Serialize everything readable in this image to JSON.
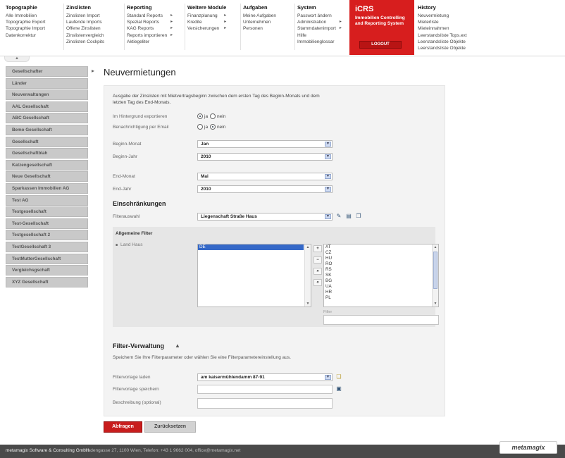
{
  "nav": {
    "columns": [
      {
        "title": "Topographie",
        "items": [
          {
            "label": "Alle Immobilien",
            "arrow": false
          },
          {
            "label": "Topographie Export",
            "arrow": false
          },
          {
            "label": "Topographie Import",
            "arrow": false
          },
          {
            "label": "Datenkorrektur",
            "arrow": false
          }
        ]
      },
      {
        "title": "Zinslisten",
        "items": [
          {
            "label": "Zinslisten Import",
            "arrow": false
          },
          {
            "label": "Laufende Imports",
            "arrow": false
          },
          {
            "label": "Offene Zinslisten",
            "arrow": false
          },
          {
            "label": "Zinslistenvergleich",
            "arrow": false
          },
          {
            "label": "Zinslisten Cockpits",
            "arrow": false
          }
        ]
      },
      {
        "title": "Reporting",
        "items": [
          {
            "label": "Standard Reports",
            "arrow": true
          },
          {
            "label": "Spezial Reports",
            "arrow": true
          },
          {
            "label": "KAG Reports",
            "arrow": true
          },
          {
            "label": "Reports importieren",
            "arrow": true
          },
          {
            "label": "Aktiegeliter",
            "arrow": false
          }
        ]
      },
      {
        "title": "Weitere Module",
        "items": [
          {
            "label": "Finanzplanung",
            "arrow": true
          },
          {
            "label": "Kredite",
            "arrow": true
          },
          {
            "label": "Versicherungen",
            "arrow": true
          }
        ]
      },
      {
        "title": "Aufgaben",
        "items": [
          {
            "label": "Meine Aufgaben",
            "arrow": false
          },
          {
            "label": "Unternehmen",
            "arrow": false
          },
          {
            "label": "Personen",
            "arrow": false
          }
        ]
      },
      {
        "title": "System",
        "items": [
          {
            "label": "Passwort ändern",
            "arrow": false
          },
          {
            "label": "Administration",
            "arrow": true
          },
          {
            "label": "Stammdatenimport",
            "arrow": true
          },
          {
            "label": "Hilfe",
            "arrow": false
          },
          {
            "label": "Immobilienglossar",
            "arrow": false
          }
        ]
      },
      {
        "title": "History",
        "items": [
          {
            "label": "Neuvermietung",
            "arrow": false
          },
          {
            "label": "Mieterliste",
            "arrow": false
          },
          {
            "label": "Mieteinnahmen",
            "arrow": false
          },
          {
            "label": "Leerstandsliste Tops.ext",
            "arrow": false
          },
          {
            "label": "Leerstandsliste Objekte",
            "arrow": false
          },
          {
            "label": "Leerstandsliste Objekte",
            "arrow": false
          }
        ]
      }
    ],
    "brand": {
      "title": "iCRS",
      "subtitle": "Immobilien Controlling and Reporting System",
      "logout": "LOGOUT"
    }
  },
  "sidebar": {
    "items": [
      "Gesellschafter",
      "Länder",
      "Neuverwaltungen",
      "AAL Gesellschaft",
      "ABC Gesellschaft",
      "Bemo Gesellschaft",
      "Gesellschaft",
      "Gesellschaftblah",
      "Katzengesellschaft",
      "Neue Gesellschaft",
      "Sparkassen Immobilien AG",
      "Test AG",
      "Testgesellschaft",
      "Test-Gesellschaft",
      "Testgesellschaft 2",
      "TestGesellschaft 3",
      "TestMutterGesellschaft",
      "Vergleichsgschaft",
      "XYZ Gesellschaft"
    ]
  },
  "page": {
    "title": "Neuvermietungen"
  },
  "form": {
    "description": "Ausgabe der Zinslisten mit Mietvertragsbeginn zwischen dem ersten Tag des Beginn-Monats und dem letzten Tag des End-Monats.",
    "bg_label": "Im Hintergrund exportieren",
    "email_label": "Benachrichtigung per Email",
    "ja": "ja",
    "nein": "nein",
    "begin_month_label": "Beginn-Monat",
    "begin_month": "Jan",
    "begin_year_label": "Beginn-Jahr",
    "begin_year": "2010",
    "end_month_label": "End-Monat",
    "end_month": "Mai",
    "end_year_label": "End-Jahr",
    "end_year": "2010"
  },
  "restrictions": {
    "heading": "Einschränkungen",
    "filter_label": "Filterauswahl",
    "filter_value": "Liegenschaft Straße Haus",
    "general_heading": "Allgemeine Filter",
    "tree_item": "Land Haus",
    "selected": [
      "DE"
    ],
    "available": [
      "AT",
      "CZ",
      "HU",
      "RO",
      "RS",
      "SK",
      "BG",
      "UA",
      "HR",
      "PL"
    ],
    "move_buttons": [
      "+",
      "−",
      "»",
      "«"
    ],
    "filter_caption": "Filter"
  },
  "filter_mgmt": {
    "heading": "Filter-Verwaltung",
    "description": "Speichern Sie Ihre Filterparameter oder wählen Sie eine Filterparametereinstellung aus.",
    "load_label": "Filtervorlage laden",
    "load_value": "am kaisermühlendamm 87-91",
    "save_label": "Filtervorlage speichern",
    "desc_label": "Beschreibung (optional)"
  },
  "buttons": {
    "submit": "Abfragen",
    "reset": "Zurücksetzen"
  },
  "footer": {
    "company": "metamagix Software & Consulting GmbH",
    "contact": "Hadengasse 27, 1100 Wien, Telefon: +43 1 9662 004, office@metamagix.net",
    "logo": "metamagix"
  },
  "colors": {
    "brand_red": "#d71e1e",
    "sidebar_gray": "#c9c9c9",
    "footer_dark": "#4a4a4a"
  }
}
